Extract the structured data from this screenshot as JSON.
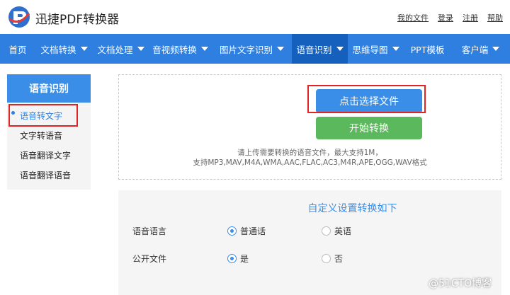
{
  "header": {
    "app_name": "迅捷PDF转换器",
    "links": [
      "我的文件",
      "登录",
      "注册",
      "帮助"
    ]
  },
  "nav": {
    "items": [
      {
        "label": "首页",
        "dropdown": false
      },
      {
        "label": "文档转换",
        "dropdown": true
      },
      {
        "label": "文档处理",
        "dropdown": true
      },
      {
        "label": "音视频转换",
        "dropdown": true
      },
      {
        "label": "图片文字识别",
        "dropdown": true
      },
      {
        "label": "语音识别",
        "dropdown": true,
        "active": true
      },
      {
        "label": "思维导图",
        "dropdown": true
      },
      {
        "label": "PPT模板",
        "dropdown": false
      },
      {
        "label": "客户端",
        "dropdown": true
      }
    ]
  },
  "sidebar": {
    "title": "语音识别",
    "items": [
      "语音转文字",
      "文字转语音",
      "语音翻译文字",
      "语音翻译语音"
    ]
  },
  "upload": {
    "select_label": "点击选择文件",
    "start_label": "开始转换",
    "hint_line1": "请上传需要转换的语音文件，最大支持1M，",
    "hint_line2": "支持MP3,MAV,M4A,WMA,AAC,FLAC,AC3,M4R,APE,OGG,WAV格式"
  },
  "settings": {
    "title": "自定义设置转换如下",
    "rows": [
      {
        "label": "语音语言",
        "options": [
          "普通话",
          "英语"
        ],
        "selected": 0
      },
      {
        "label": "公开文件",
        "options": [
          "是",
          "否"
        ],
        "selected": 0
      }
    ]
  },
  "watermark": "@51CTO博客",
  "colors": {
    "nav_blue": "#2e7fe0",
    "nav_active": "#1560bd",
    "green": "#5cb85c",
    "highlight_red": "#e02424"
  }
}
